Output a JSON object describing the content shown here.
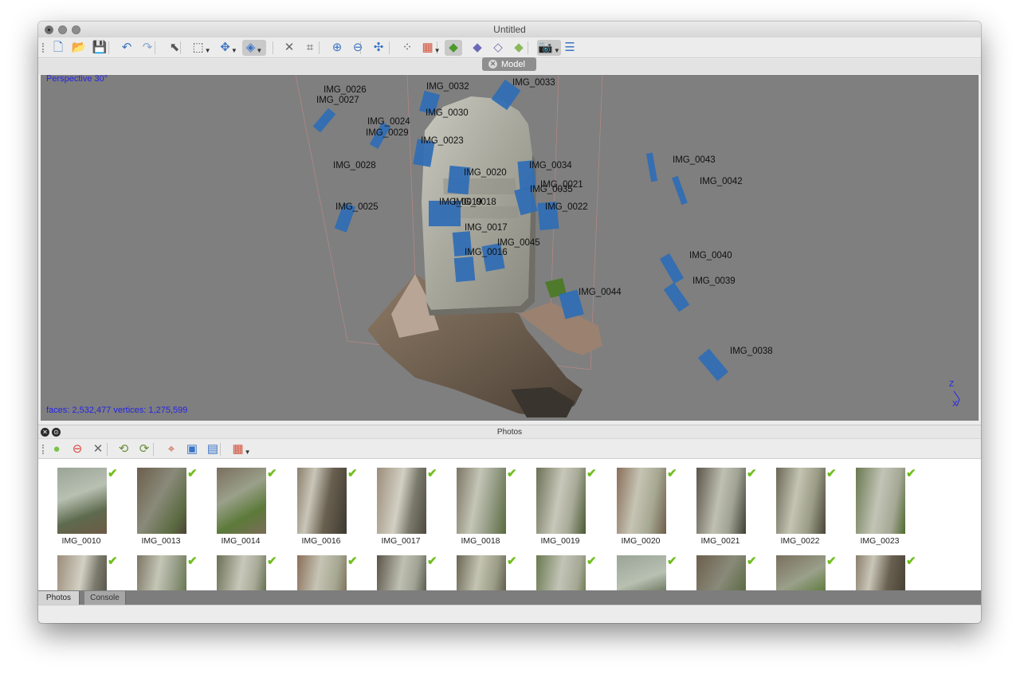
{
  "window": {
    "title": "Untitled"
  },
  "toolbar": {
    "buttons": [
      {
        "name": "new-document-icon",
        "glyph": "🗋",
        "color": "#3a74c4"
      },
      {
        "name": "open-folder-icon",
        "glyph": "📂",
        "color": "#d9a630"
      },
      {
        "name": "save-icon",
        "glyph": "💾",
        "color": "#3a74c4"
      },
      {
        "name": "undo-icon",
        "glyph": "↶",
        "color": "#3a74c4"
      },
      {
        "name": "redo-icon",
        "glyph": "↷",
        "color": "#8aa6d0"
      },
      {
        "name": "select-pointer-icon",
        "glyph": "⬉",
        "color": "#555555"
      },
      {
        "name": "rectangle-select-icon",
        "glyph": "⬚",
        "color": "#555555"
      },
      {
        "name": "navigation-mode-icon",
        "glyph": "✥",
        "color": "#3a74c4"
      },
      {
        "name": "rotate-object-icon",
        "glyph": "◈",
        "color": "#3a74c4"
      },
      {
        "name": "delete-selection-icon",
        "glyph": "✕",
        "color": "#666666"
      },
      {
        "name": "crop-icon",
        "glyph": "⌗",
        "color": "#555555"
      },
      {
        "name": "zoom-in-icon",
        "glyph": "⊕",
        "color": "#3a74c4"
      },
      {
        "name": "zoom-out-icon",
        "glyph": "⊖",
        "color": "#3a74c4"
      },
      {
        "name": "reset-view-icon",
        "glyph": "✣",
        "color": "#3a74c4"
      },
      {
        "name": "point-cloud-icon",
        "glyph": "⁘",
        "color": "#555555"
      },
      {
        "name": "dense-cloud-icon",
        "glyph": "▦",
        "color": "#d0503a"
      },
      {
        "name": "shaded-model-icon",
        "glyph": "◆",
        "color": "#4a9a2a"
      },
      {
        "name": "solid-model-icon",
        "glyph": "◆",
        "color": "#6a6ab8"
      },
      {
        "name": "wireframe-model-icon",
        "glyph": "◇",
        "color": "#7070b0"
      },
      {
        "name": "textured-model-icon",
        "glyph": "◆",
        "color": "#8ab85a"
      },
      {
        "name": "show-cameras-icon",
        "glyph": "📷",
        "color": "#555555"
      },
      {
        "name": "show-regions-icon",
        "glyph": "☰",
        "color": "#3a74c4"
      }
    ]
  },
  "model_tab": {
    "label": "Model"
  },
  "viewport": {
    "projection_label": "Perspective 30°",
    "stats_label": "faces: 2,532,477 vertices: 1,275,599",
    "axis_z": "Z",
    "axis_x": "X",
    "cameras": [
      {
        "label": "IMG_0026"
      },
      {
        "label": "IMG_0027"
      },
      {
        "label": "IMG_0032"
      },
      {
        "label": "IMG_0033"
      },
      {
        "label": "IMG_0030"
      },
      {
        "label": "IMG_0024"
      },
      {
        "label": "IMG_0029"
      },
      {
        "label": "IMG_0023"
      },
      {
        "label": "IMG_0028"
      },
      {
        "label": "IMG_0020"
      },
      {
        "label": "IMG_0034"
      },
      {
        "label": "IMG_0021"
      },
      {
        "label": "IMG_0035"
      },
      {
        "label": "IMG_0019"
      },
      {
        "label": "IMG_0018"
      },
      {
        "label": "IMG_0022"
      },
      {
        "label": "IMG_0025"
      },
      {
        "label": "IMG_0017"
      },
      {
        "label": "IMG_0045"
      },
      {
        "label": "IMG_0016"
      },
      {
        "label": "IMG_0043"
      },
      {
        "label": "IMG_0042"
      },
      {
        "label": "IMG_0040"
      },
      {
        "label": "IMG_0039"
      },
      {
        "label": "IMG_0044"
      },
      {
        "label": "IMG_0038"
      }
    ]
  },
  "photos_panel": {
    "title": "Photos",
    "toolbar": [
      {
        "name": "enable-camera-icon",
        "glyph": "●",
        "color": "#7cc24a"
      },
      {
        "name": "disable-camera-icon",
        "glyph": "⊖",
        "color": "#d9433b"
      },
      {
        "name": "remove-photo-icon",
        "glyph": "✕",
        "color": "#666666"
      },
      {
        "name": "rotate-left-icon",
        "glyph": "⟲",
        "color": "#6b8e3a"
      },
      {
        "name": "rotate-right-icon",
        "glyph": "⟳",
        "color": "#6b8e3a"
      },
      {
        "name": "filter-by-point-icon",
        "glyph": "⌖",
        "color": "#c25a3a"
      },
      {
        "name": "reset-filter-icon",
        "glyph": "▣",
        "color": "#3a74c4"
      },
      {
        "name": "open-image-icon",
        "glyph": "▤",
        "color": "#3a74c4"
      },
      {
        "name": "view-mode-icon",
        "glyph": "▦",
        "color": "#d0503a"
      }
    ],
    "row1": [
      {
        "label": "IMG_0010",
        "enabled": true
      },
      {
        "label": "IMG_0013",
        "enabled": true
      },
      {
        "label": "IMG_0014",
        "enabled": true
      },
      {
        "label": "IMG_0016",
        "enabled": true
      },
      {
        "label": "IMG_0017",
        "enabled": true
      },
      {
        "label": "IMG_0018",
        "enabled": true
      },
      {
        "label": "IMG_0019",
        "enabled": true
      },
      {
        "label": "IMG_0020",
        "enabled": true
      },
      {
        "label": "IMG_0021",
        "enabled": true
      },
      {
        "label": "IMG_0022",
        "enabled": true
      },
      {
        "label": "IMG_0023",
        "enabled": true
      }
    ],
    "row2_count": 11
  },
  "bottom_tabs": [
    {
      "label": "Photos",
      "active": true
    },
    {
      "label": "Console",
      "active": false
    }
  ],
  "colors": {
    "viewport_bg": "#7f7f7f",
    "camera_plane": "#2f6db5",
    "overlay_text": "#2323e8",
    "check": "#6fbf1c"
  }
}
